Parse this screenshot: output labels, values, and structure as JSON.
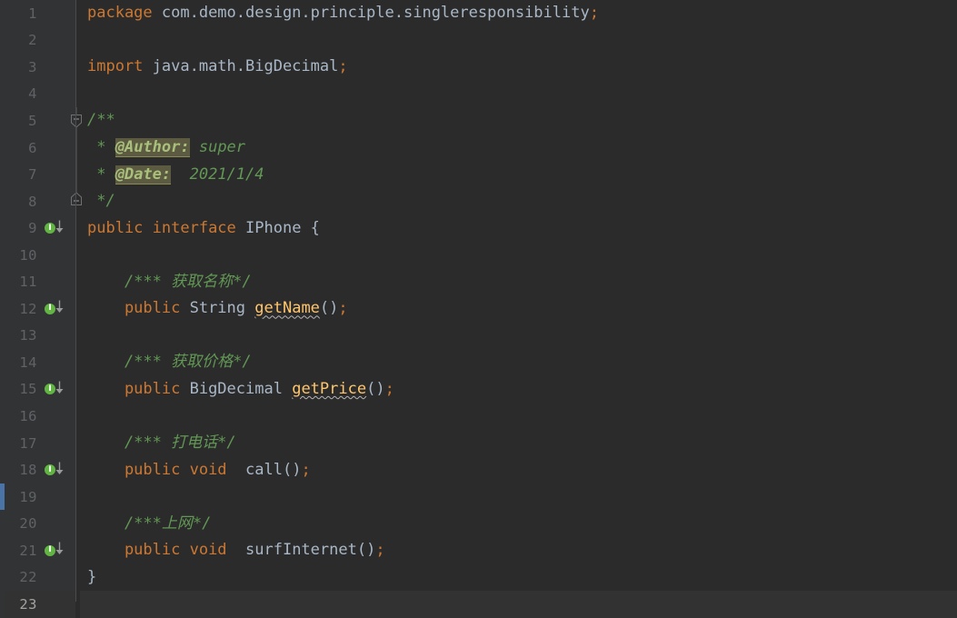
{
  "editor": {
    "theme": "darcula",
    "background": "#2b2b2b",
    "gutter_background": "#313335",
    "current_line": 23,
    "total_lines": 23,
    "language": "java",
    "colors": {
      "keyword": "#cc7832",
      "comment": "#629755",
      "doc_tag": "#a9bf7c",
      "doc_tag_highlight": "#5c5b41",
      "identifier": "#a9b7c6",
      "method_warn": "#ffc66d",
      "line_number": "#606366",
      "current_line_number": "#a4a3a0",
      "gutter_icon_green": "#62b543",
      "marker_blue": "#4a74a8"
    },
    "icons": {
      "interface_marker": "I",
      "fold_collapse": "−"
    }
  },
  "lines": [
    {
      "n": "1",
      "marker": "",
      "icon": false,
      "fold": "",
      "tokens": [
        {
          "c": "kw",
          "t": "package"
        },
        {
          "c": "txt",
          "t": " com.demo.design.principle.singleresponsibility"
        },
        {
          "c": "semi",
          "t": ";"
        }
      ]
    },
    {
      "n": "2",
      "marker": "",
      "icon": false,
      "fold": "",
      "tokens": []
    },
    {
      "n": "3",
      "marker": "",
      "icon": false,
      "fold": "",
      "tokens": [
        {
          "c": "kw",
          "t": "import"
        },
        {
          "c": "txt",
          "t": " java.math.BigDecimal"
        },
        {
          "c": "semi",
          "t": ";"
        }
      ]
    },
    {
      "n": "4",
      "marker": "",
      "icon": false,
      "fold": "",
      "tokens": []
    },
    {
      "n": "5",
      "marker": "",
      "icon": false,
      "fold": "start",
      "tokens": [
        {
          "c": "cmt",
          "t": "/**"
        }
      ]
    },
    {
      "n": "6",
      "marker": "",
      "icon": false,
      "fold": "mid",
      "tokens": [
        {
          "c": "cmt",
          "t": " * "
        },
        {
          "c": "doctag",
          "t": "@Author:"
        },
        {
          "c": "docval",
          "t": " super"
        }
      ]
    },
    {
      "n": "7",
      "marker": "",
      "icon": false,
      "fold": "mid",
      "tokens": [
        {
          "c": "cmt",
          "t": " * "
        },
        {
          "c": "doctag",
          "t": "@Date:"
        },
        {
          "c": "docval",
          "t": "  2021/1/4"
        }
      ]
    },
    {
      "n": "8",
      "marker": "",
      "icon": false,
      "fold": "end",
      "tokens": [
        {
          "c": "cmt",
          "t": " */"
        }
      ]
    },
    {
      "n": "9",
      "marker": "",
      "icon": true,
      "fold": "",
      "tokens": [
        {
          "c": "kw",
          "t": "public"
        },
        {
          "c": "kw",
          "t": " interface"
        },
        {
          "c": "cls",
          "t": " IPhone"
        },
        {
          "c": "plain",
          "t": " {"
        }
      ]
    },
    {
      "n": "10",
      "marker": "",
      "icon": false,
      "fold": "",
      "tokens": []
    },
    {
      "n": "11",
      "marker": "",
      "icon": false,
      "fold": "",
      "tokens": [
        {
          "c": "cmt",
          "t": "    /*** 获取名称*/"
        }
      ]
    },
    {
      "n": "12",
      "marker": "",
      "icon": true,
      "fold": "",
      "tokens": [
        {
          "c": "kw",
          "t": "    public"
        },
        {
          "c": "cls",
          "t": " String"
        },
        {
          "c": "plain",
          "t": " "
        },
        {
          "c": "method-err",
          "t": "getName"
        },
        {
          "c": "plain",
          "t": "()"
        },
        {
          "c": "semi",
          "t": ";"
        }
      ]
    },
    {
      "n": "13",
      "marker": "",
      "icon": false,
      "fold": "",
      "tokens": []
    },
    {
      "n": "14",
      "marker": "",
      "icon": false,
      "fold": "",
      "tokens": [
        {
          "c": "cmt",
          "t": "    /*** 获取价格*/"
        }
      ]
    },
    {
      "n": "15",
      "marker": "",
      "icon": true,
      "fold": "",
      "tokens": [
        {
          "c": "kw",
          "t": "    public"
        },
        {
          "c": "cls",
          "t": " BigDecimal"
        },
        {
          "c": "plain",
          "t": " "
        },
        {
          "c": "method-err",
          "t": "getPrice"
        },
        {
          "c": "plain",
          "t": "()"
        },
        {
          "c": "semi",
          "t": ";"
        }
      ]
    },
    {
      "n": "16",
      "marker": "",
      "icon": false,
      "fold": "",
      "tokens": []
    },
    {
      "n": "17",
      "marker": "",
      "icon": false,
      "fold": "",
      "tokens": [
        {
          "c": "cmt",
          "t": "    /*** 打电话*/"
        }
      ]
    },
    {
      "n": "18",
      "marker": "",
      "icon": true,
      "fold": "",
      "tokens": [
        {
          "c": "kw",
          "t": "    public"
        },
        {
          "c": "kw",
          "t": " void"
        },
        {
          "c": "plain",
          "t": "  call()"
        },
        {
          "c": "semi",
          "t": ";"
        }
      ]
    },
    {
      "n": "19",
      "marker": "blue",
      "icon": false,
      "fold": "",
      "tokens": []
    },
    {
      "n": "20",
      "marker": "",
      "icon": false,
      "fold": "",
      "tokens": [
        {
          "c": "cmt",
          "t": "    /***上网*/"
        }
      ]
    },
    {
      "n": "21",
      "marker": "",
      "icon": true,
      "fold": "",
      "tokens": [
        {
          "c": "kw",
          "t": "    public"
        },
        {
          "c": "kw",
          "t": " void"
        },
        {
          "c": "plain",
          "t": "  surfInternet()"
        },
        {
          "c": "semi",
          "t": ";"
        }
      ]
    },
    {
      "n": "22",
      "marker": "",
      "icon": false,
      "fold": "",
      "tokens": [
        {
          "c": "plain",
          "t": "}"
        }
      ]
    },
    {
      "n": "23",
      "marker": "",
      "icon": false,
      "fold": "",
      "tokens": []
    }
  ]
}
